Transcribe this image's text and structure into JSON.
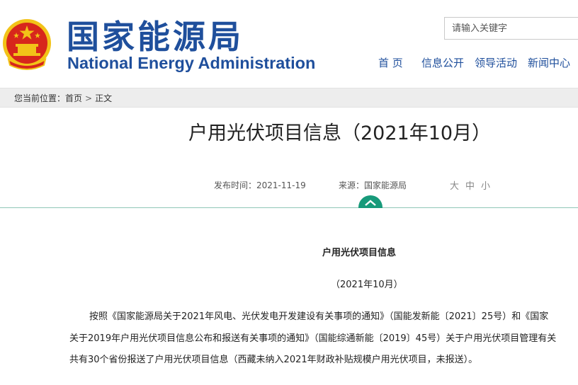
{
  "header": {
    "site_name_cn": "国家能源局",
    "site_name_en": "National Energy Administration",
    "search_placeholder": "请输入关键字",
    "nav": [
      {
        "label": "首 页"
      },
      {
        "label": "信息公开"
      },
      {
        "label": "领导活动"
      },
      {
        "label": "新闻中心"
      }
    ]
  },
  "breadcrumb": {
    "prefix": "您当前位置：",
    "home": "首页",
    "separator": ">",
    "current": "正文"
  },
  "article": {
    "title": "户用光伏项目信息（2021年10月）",
    "publish_label": "发布时间：2021-11-19",
    "source_label": "来源：国家能源局",
    "font_sizes": [
      "大",
      "中",
      "小"
    ],
    "body_title": "户用光伏项目信息",
    "body_date": "（2021年10月）",
    "lines": [
      "按照《国家能源局关于2021年风电、光伏发电开发建设有关事项的通知》（国能发新能〔2021〕25号）和《国家",
      "关于2019年户用光伏项目信息公布和报送有关事项的通知》（国能综通新能〔2019〕45号）关于户用光伏项目管理有关",
      "共有30个省份报送了户用光伏项目信息（西藏未纳入2021年财政补贴规模户用光伏项目，未报送）。"
    ]
  },
  "colors": {
    "brand_blue": "#1f4f9c",
    "accent_green": "#179a7a",
    "emblem_red": "#d7261c",
    "emblem_gold": "#f2c318"
  },
  "icons": {
    "emblem": "national-emblem-icon",
    "toggle": "chevron-up-icon"
  }
}
